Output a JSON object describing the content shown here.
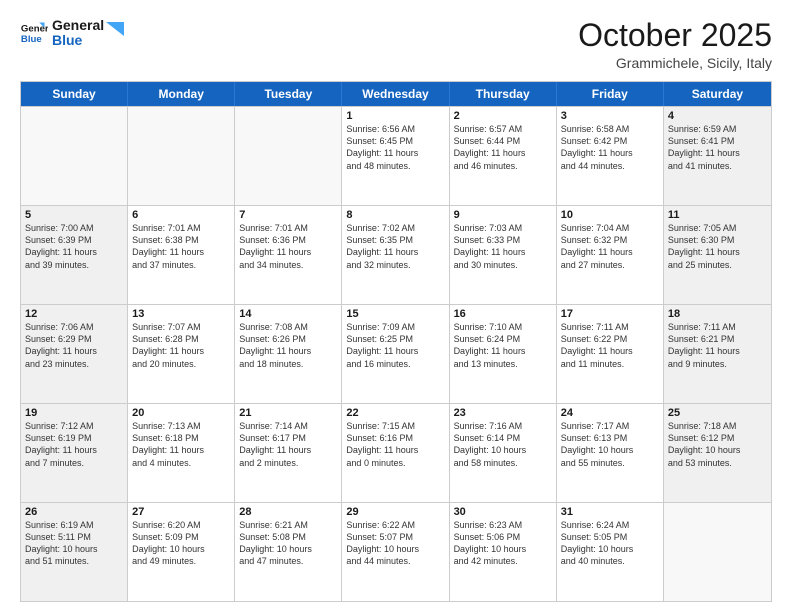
{
  "header": {
    "logo_line1": "General",
    "logo_line2": "Blue",
    "month": "October 2025",
    "location": "Grammichele, Sicily, Italy"
  },
  "days_of_week": [
    "Sunday",
    "Monday",
    "Tuesday",
    "Wednesday",
    "Thursday",
    "Friday",
    "Saturday"
  ],
  "weeks": [
    [
      {
        "day": "",
        "text": "",
        "empty": true
      },
      {
        "day": "",
        "text": "",
        "empty": true
      },
      {
        "day": "",
        "text": "",
        "empty": true
      },
      {
        "day": "1",
        "text": "Sunrise: 6:56 AM\nSunset: 6:45 PM\nDaylight: 11 hours\nand 48 minutes.",
        "empty": false,
        "shaded": false
      },
      {
        "day": "2",
        "text": "Sunrise: 6:57 AM\nSunset: 6:44 PM\nDaylight: 11 hours\nand 46 minutes.",
        "empty": false,
        "shaded": false
      },
      {
        "day": "3",
        "text": "Sunrise: 6:58 AM\nSunset: 6:42 PM\nDaylight: 11 hours\nand 44 minutes.",
        "empty": false,
        "shaded": false
      },
      {
        "day": "4",
        "text": "Sunrise: 6:59 AM\nSunset: 6:41 PM\nDaylight: 11 hours\nand 41 minutes.",
        "empty": false,
        "shaded": true
      }
    ],
    [
      {
        "day": "5",
        "text": "Sunrise: 7:00 AM\nSunset: 6:39 PM\nDaylight: 11 hours\nand 39 minutes.",
        "empty": false,
        "shaded": true
      },
      {
        "day": "6",
        "text": "Sunrise: 7:01 AM\nSunset: 6:38 PM\nDaylight: 11 hours\nand 37 minutes.",
        "empty": false,
        "shaded": false
      },
      {
        "day": "7",
        "text": "Sunrise: 7:01 AM\nSunset: 6:36 PM\nDaylight: 11 hours\nand 34 minutes.",
        "empty": false,
        "shaded": false
      },
      {
        "day": "8",
        "text": "Sunrise: 7:02 AM\nSunset: 6:35 PM\nDaylight: 11 hours\nand 32 minutes.",
        "empty": false,
        "shaded": false
      },
      {
        "day": "9",
        "text": "Sunrise: 7:03 AM\nSunset: 6:33 PM\nDaylight: 11 hours\nand 30 minutes.",
        "empty": false,
        "shaded": false
      },
      {
        "day": "10",
        "text": "Sunrise: 7:04 AM\nSunset: 6:32 PM\nDaylight: 11 hours\nand 27 minutes.",
        "empty": false,
        "shaded": false
      },
      {
        "day": "11",
        "text": "Sunrise: 7:05 AM\nSunset: 6:30 PM\nDaylight: 11 hours\nand 25 minutes.",
        "empty": false,
        "shaded": true
      }
    ],
    [
      {
        "day": "12",
        "text": "Sunrise: 7:06 AM\nSunset: 6:29 PM\nDaylight: 11 hours\nand 23 minutes.",
        "empty": false,
        "shaded": true
      },
      {
        "day": "13",
        "text": "Sunrise: 7:07 AM\nSunset: 6:28 PM\nDaylight: 11 hours\nand 20 minutes.",
        "empty": false,
        "shaded": false
      },
      {
        "day": "14",
        "text": "Sunrise: 7:08 AM\nSunset: 6:26 PM\nDaylight: 11 hours\nand 18 minutes.",
        "empty": false,
        "shaded": false
      },
      {
        "day": "15",
        "text": "Sunrise: 7:09 AM\nSunset: 6:25 PM\nDaylight: 11 hours\nand 16 minutes.",
        "empty": false,
        "shaded": false
      },
      {
        "day": "16",
        "text": "Sunrise: 7:10 AM\nSunset: 6:24 PM\nDaylight: 11 hours\nand 13 minutes.",
        "empty": false,
        "shaded": false
      },
      {
        "day": "17",
        "text": "Sunrise: 7:11 AM\nSunset: 6:22 PM\nDaylight: 11 hours\nand 11 minutes.",
        "empty": false,
        "shaded": false
      },
      {
        "day": "18",
        "text": "Sunrise: 7:11 AM\nSunset: 6:21 PM\nDaylight: 11 hours\nand 9 minutes.",
        "empty": false,
        "shaded": true
      }
    ],
    [
      {
        "day": "19",
        "text": "Sunrise: 7:12 AM\nSunset: 6:19 PM\nDaylight: 11 hours\nand 7 minutes.",
        "empty": false,
        "shaded": true
      },
      {
        "day": "20",
        "text": "Sunrise: 7:13 AM\nSunset: 6:18 PM\nDaylight: 11 hours\nand 4 minutes.",
        "empty": false,
        "shaded": false
      },
      {
        "day": "21",
        "text": "Sunrise: 7:14 AM\nSunset: 6:17 PM\nDaylight: 11 hours\nand 2 minutes.",
        "empty": false,
        "shaded": false
      },
      {
        "day": "22",
        "text": "Sunrise: 7:15 AM\nSunset: 6:16 PM\nDaylight: 11 hours\nand 0 minutes.",
        "empty": false,
        "shaded": false
      },
      {
        "day": "23",
        "text": "Sunrise: 7:16 AM\nSunset: 6:14 PM\nDaylight: 10 hours\nand 58 minutes.",
        "empty": false,
        "shaded": false
      },
      {
        "day": "24",
        "text": "Sunrise: 7:17 AM\nSunset: 6:13 PM\nDaylight: 10 hours\nand 55 minutes.",
        "empty": false,
        "shaded": false
      },
      {
        "day": "25",
        "text": "Sunrise: 7:18 AM\nSunset: 6:12 PM\nDaylight: 10 hours\nand 53 minutes.",
        "empty": false,
        "shaded": true
      }
    ],
    [
      {
        "day": "26",
        "text": "Sunrise: 6:19 AM\nSunset: 5:11 PM\nDaylight: 10 hours\nand 51 minutes.",
        "empty": false,
        "shaded": true
      },
      {
        "day": "27",
        "text": "Sunrise: 6:20 AM\nSunset: 5:09 PM\nDaylight: 10 hours\nand 49 minutes.",
        "empty": false,
        "shaded": false
      },
      {
        "day": "28",
        "text": "Sunrise: 6:21 AM\nSunset: 5:08 PM\nDaylight: 10 hours\nand 47 minutes.",
        "empty": false,
        "shaded": false
      },
      {
        "day": "29",
        "text": "Sunrise: 6:22 AM\nSunset: 5:07 PM\nDaylight: 10 hours\nand 44 minutes.",
        "empty": false,
        "shaded": false
      },
      {
        "day": "30",
        "text": "Sunrise: 6:23 AM\nSunset: 5:06 PM\nDaylight: 10 hours\nand 42 minutes.",
        "empty": false,
        "shaded": false
      },
      {
        "day": "31",
        "text": "Sunrise: 6:24 AM\nSunset: 5:05 PM\nDaylight: 10 hours\nand 40 minutes.",
        "empty": false,
        "shaded": false
      },
      {
        "day": "",
        "text": "",
        "empty": true,
        "shaded": true
      }
    ]
  ]
}
